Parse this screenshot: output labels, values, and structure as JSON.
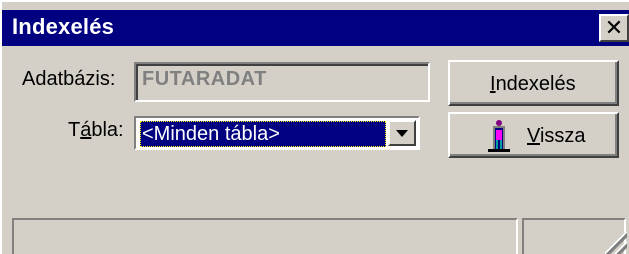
{
  "window": {
    "title": "Indexelés",
    "close_glyph": "✕"
  },
  "form": {
    "database_label": "Adatbázis:",
    "database_value": "FUTARADAT",
    "table_label_pre": "T",
    "table_label_mnemonic": "á",
    "table_label_post": "bla:",
    "table_selected": "<Minden tábla>"
  },
  "buttons": {
    "index": {
      "mnemonic": "I",
      "rest": "ndexelés"
    },
    "back": {
      "mnemonic": "V",
      "rest": "issza",
      "icon": "door-exit-icon"
    }
  },
  "statusbar": {
    "panel1": "",
    "panel2": ""
  },
  "colors": {
    "titlebar": "#000080",
    "face": "#d4d0c8",
    "selection": "#000080"
  }
}
